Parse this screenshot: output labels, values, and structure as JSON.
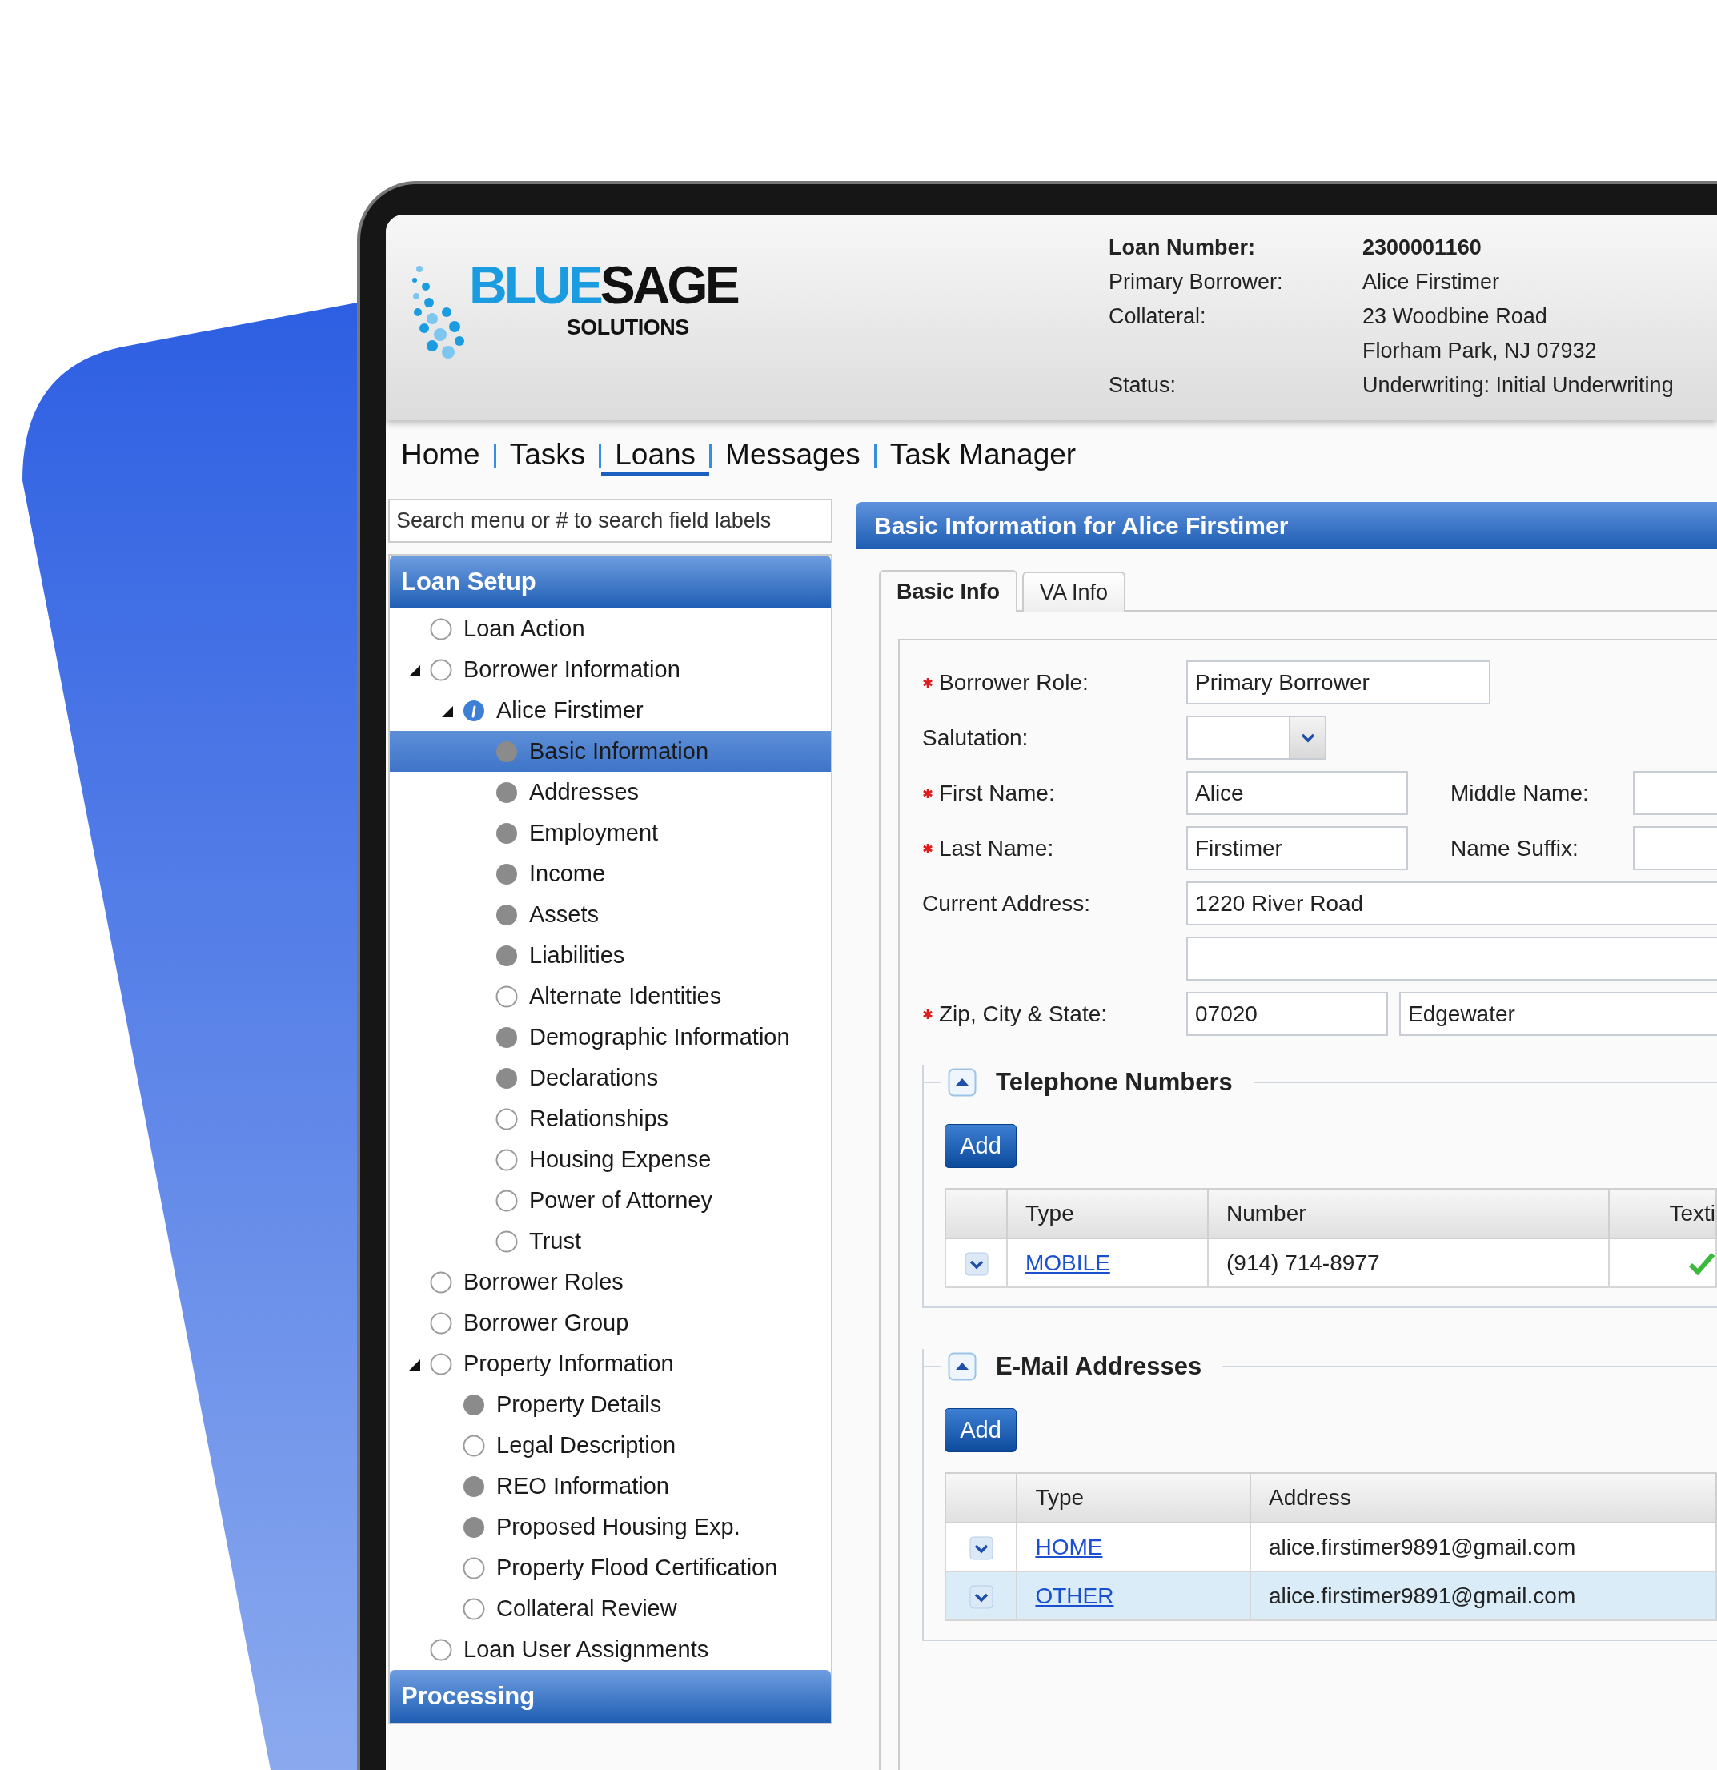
{
  "header": {
    "logo": {
      "primary": "BLUE",
      "secondary": "SAGE",
      "tagline": "SOLUTIONS"
    },
    "loan_info": [
      {
        "label": "Loan Number:",
        "values": [
          "2300001160"
        ],
        "bold": true
      },
      {
        "label": "Primary Borrower:",
        "values": [
          "Alice Firstimer"
        ],
        "bold": false
      },
      {
        "label": "Collateral:",
        "values": [
          "23 Woodbine Road",
          "Florham Park, NJ 07932"
        ],
        "bold": false
      },
      {
        "label": "Status:",
        "values": [
          "Underwriting: Initial Underwriting"
        ],
        "bold": false
      }
    ]
  },
  "nav": [
    {
      "label": "Home",
      "selected": false
    },
    {
      "label": "Tasks",
      "selected": false
    },
    {
      "label": "Loans",
      "selected": true
    },
    {
      "label": "Messages",
      "selected": false
    },
    {
      "label": "Task Manager",
      "selected": false
    }
  ],
  "sidebar": {
    "search": {
      "placeholder": "Search menu or # to search field labels"
    },
    "sections": [
      {
        "title": "Loan Setup",
        "items": [
          {
            "label": "Loan Action",
            "kind": "empty",
            "selected": false
          },
          {
            "label": "Borrower Information",
            "kind": "empty",
            "selected": false,
            "expanded": true,
            "children": [
              {
                "label": "Alice Firstimer",
                "kind": "info",
                "selected": false,
                "expanded": true,
                "children": [
                  {
                    "label": "Basic Information",
                    "kind": "complete",
                    "selected": true
                  },
                  {
                    "label": "Addresses",
                    "kind": "complete",
                    "selected": false
                  },
                  {
                    "label": "Employment",
                    "kind": "complete",
                    "selected": false
                  },
                  {
                    "label": "Income",
                    "kind": "complete",
                    "selected": false
                  },
                  {
                    "label": "Assets",
                    "kind": "complete",
                    "selected": false
                  },
                  {
                    "label": "Liabilities",
                    "kind": "complete",
                    "selected": false
                  },
                  {
                    "label": "Alternate Identities",
                    "kind": "empty",
                    "selected": false
                  },
                  {
                    "label": "Demographic Information",
                    "kind": "complete",
                    "selected": false
                  },
                  {
                    "label": "Declarations",
                    "kind": "complete",
                    "selected": false
                  },
                  {
                    "label": "Relationships",
                    "kind": "empty",
                    "selected": false
                  },
                  {
                    "label": "Housing Expense",
                    "kind": "empty",
                    "selected": false
                  },
                  {
                    "label": "Power of Attorney",
                    "kind": "empty",
                    "selected": false
                  },
                  {
                    "label": "Trust",
                    "kind": "empty",
                    "selected": false
                  }
                ]
              }
            ]
          },
          {
            "label": "Borrower Roles",
            "kind": "empty",
            "selected": false
          },
          {
            "label": "Borrower Group",
            "kind": "empty",
            "selected": false
          },
          {
            "label": "Property Information",
            "kind": "empty",
            "selected": false,
            "expanded": true,
            "children": [
              {
                "label": "Property Details",
                "kind": "complete",
                "selected": false
              },
              {
                "label": "Legal Description",
                "kind": "empty",
                "selected": false
              },
              {
                "label": "REO Information",
                "kind": "complete",
                "selected": false
              },
              {
                "label": "Proposed Housing Exp.",
                "kind": "complete",
                "selected": false
              },
              {
                "label": "Property Flood Certification",
                "kind": "empty",
                "selected": false
              },
              {
                "label": "Collateral Review",
                "kind": "empty",
                "selected": false
              }
            ]
          },
          {
            "label": "Loan User Assignments",
            "kind": "empty",
            "selected": false
          }
        ]
      },
      {
        "title": "Processing"
      }
    ]
  },
  "panel": {
    "title": "Basic Information for Alice Firstimer",
    "tabs": [
      {
        "label": "Basic Info",
        "selected": true
      },
      {
        "label": "VA Info",
        "selected": false
      }
    ],
    "form": [
      {
        "label": "Borrower Role:",
        "required": true,
        "inputs": [
          {
            "kind": "text",
            "value": "Primary Borrower"
          }
        ]
      },
      {
        "label": "Salutation:",
        "required": false,
        "inputs": [
          {
            "kind": "select"
          }
        ]
      },
      {
        "label": "First Name:",
        "required": true,
        "inputs": [
          {
            "kind": "text",
            "value": "Alice"
          }
        ],
        "side": {
          "label": "Middle Name:"
        }
      },
      {
        "label": "Last Name:",
        "required": true,
        "inputs": [
          {
            "kind": "text",
            "value": "Firstimer"
          }
        ],
        "side": {
          "label": "Name Suffix:"
        }
      },
      {
        "label": "Current Address:",
        "required": false,
        "inputs": [
          {
            "kind": "text",
            "value": "1220 River Road"
          }
        ]
      },
      {
        "required": false,
        "inputs": [
          {
            "kind": "text"
          }
        ]
      },
      {
        "label": "Zip, City & State:",
        "required": true,
        "inputs": [
          {
            "kind": "text",
            "value": "07020"
          },
          {
            "kind": "text",
            "value": "Edgewater"
          }
        ]
      }
    ],
    "sections": [
      {
        "title": "Telephone Numbers",
        "expanded": true,
        "add_button": "Add",
        "table": {
          "columns": [
            "Type",
            "Number",
            "Texti"
          ],
          "rows": [
            {
              "selected": false,
              "cells": [
                "MOBILE",
                "(914) 714-8977"
              ],
              "texting": true
            }
          ]
        }
      },
      {
        "title": "E-Mail Addresses",
        "expanded": true,
        "add_button": "Add",
        "table": {
          "columns": [
            "Type",
            "Address"
          ],
          "rows": [
            {
              "selected": false,
              "cells": [
                "HOME",
                "alice.firstimer9891@gmail.com"
              ]
            },
            {
              "selected": true,
              "cells": [
                "OTHER",
                "alice.firstimer9891@gmail.com"
              ]
            }
          ]
        }
      }
    ]
  }
}
